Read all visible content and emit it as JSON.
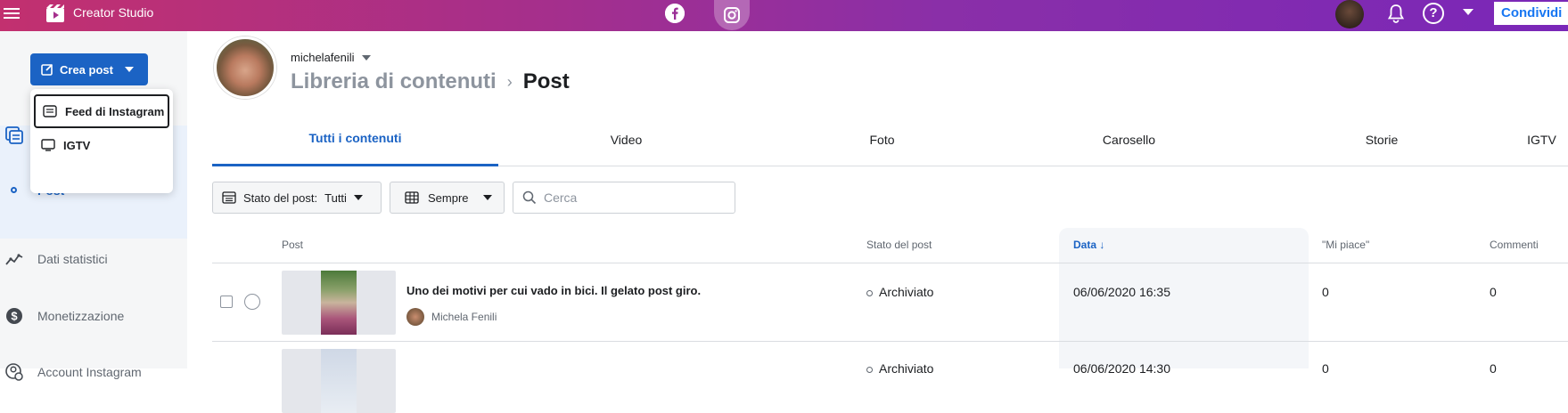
{
  "topbar": {
    "app_title": "Creator Studio",
    "share_label": "Condividi",
    "help_glyph": "?"
  },
  "sidebar": {
    "create_label": "Crea post",
    "dropdown": [
      {
        "label": "Feed di Instagram",
        "icon": "feed-icon"
      },
      {
        "label": "IGTV",
        "icon": "tv-icon"
      }
    ],
    "post_label": "Post",
    "items": [
      {
        "label": "Dati statistici",
        "icon": "insights-icon"
      },
      {
        "label": "Monetizzazione",
        "icon": "dollar-icon"
      },
      {
        "label": "Account Instagram",
        "icon": "account-settings-icon"
      }
    ]
  },
  "header": {
    "account_name": "michelafenili",
    "breadcrumb_library": "Libreria di contenuti",
    "breadcrumb_separator": "›",
    "breadcrumb_current": "Post"
  },
  "tabs": [
    "Tutti i contenuti",
    "Video",
    "Foto",
    "Carosello",
    "Storie",
    "IGTV"
  ],
  "filters": {
    "status_label": "Stato del post:",
    "status_value": "Tutti",
    "date_value": "Sempre",
    "search_placeholder": "Cerca"
  },
  "table": {
    "columns": [
      "Post",
      "Stato del post",
      "Data ↓",
      "\"Mi piace\"",
      "Commenti"
    ],
    "rows": [
      {
        "title": "Uno dei motivi per cui vado in bici. Il gelato post giro.",
        "author": "Michela Fenili",
        "status": "Archiviato",
        "date": "06/06/2020 16:35",
        "likes": "0",
        "comments": "0"
      },
      {
        "title": "",
        "author": "",
        "status": "Archiviato",
        "date": "06/06/2020 14:30",
        "likes": "0",
        "comments": "0"
      }
    ]
  },
  "colors": {
    "accent": "#1b63c4",
    "topbar_start": "#c2306f",
    "topbar_end": "#7a27b8"
  }
}
